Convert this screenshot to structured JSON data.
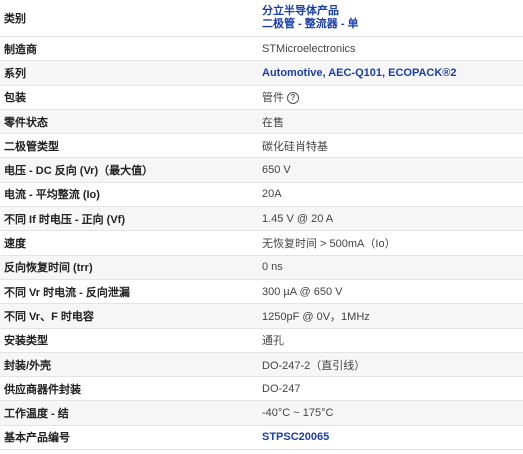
{
  "category": {
    "label": "类别",
    "value_line1": "分立半导体产品",
    "value_line2": "二极管 - 整流器 - 单"
  },
  "rows": [
    {
      "label": "制造商",
      "value": "STMicroelectronics"
    },
    {
      "label": "系列",
      "value": "Automotive, AEC-Q101, ECOPACK®2"
    },
    {
      "label": "包装",
      "value": "管件",
      "help_icon": "?"
    },
    {
      "label": "零件状态",
      "value": "在售"
    },
    {
      "label": "二极管类型",
      "value": "碳化硅肖特基"
    },
    {
      "label": "电压 - DC 反向 (Vr)（最大值）",
      "value": "650 V"
    },
    {
      "label": "电流 - 平均整流 (Io)",
      "value": "20A"
    },
    {
      "label": "不同 If 时电压 - 正向 (Vf)",
      "value": "1.45 V @ 20 A"
    },
    {
      "label": "速度",
      "value": "无恢复时间 > 500mA（Io）"
    },
    {
      "label": "反向恢复时间 (trr)",
      "value": "0 ns"
    },
    {
      "label": "不同 Vr 时电流 - 反向泄漏",
      "value": "300 µA @ 650 V"
    },
    {
      "label": "不同 Vr、F 时电容",
      "value": "1250pF @ 0V，1MHz"
    },
    {
      "label": "安装类型",
      "value": "通孔"
    },
    {
      "label": "封装/外壳",
      "value": "DO-247-2（直引线）"
    },
    {
      "label": "供应商器件封装",
      "value": "DO-247"
    },
    {
      "label": "工作温度 - 结",
      "value": "-40°C ~ 175°C"
    },
    {
      "label": "基本产品编号",
      "value": "STPSC20065"
    }
  ],
  "colors": {
    "link": "#1a3fa8",
    "row_alt": "#f6f6f6",
    "border": "#e3e3e3"
  }
}
